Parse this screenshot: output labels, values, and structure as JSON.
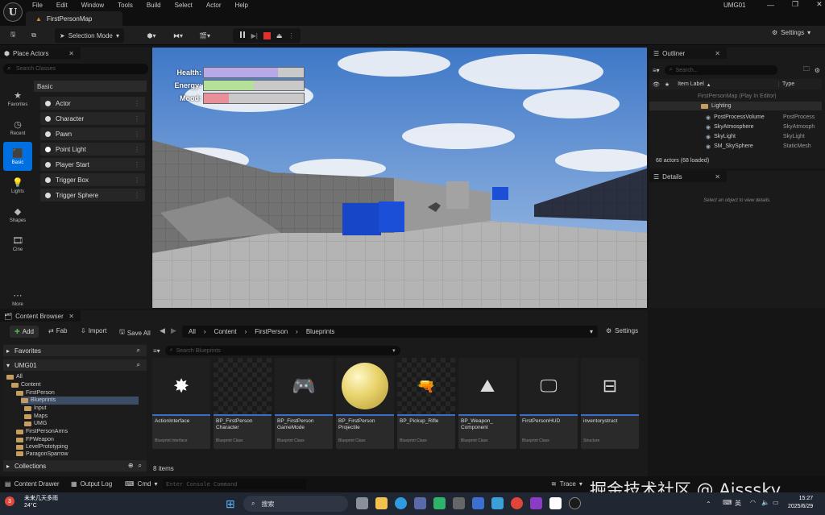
{
  "window": {
    "project_name": "UMG01",
    "map_tab": "FirstPersonMap",
    "menu": [
      "File",
      "Edit",
      "Window",
      "Tools",
      "Build",
      "Select",
      "Actor",
      "Help"
    ],
    "logo_letter": "U"
  },
  "toolbar": {
    "selection_mode": "Selection Mode",
    "settings": "Settings"
  },
  "place_actors": {
    "tab_title": "Place Actors",
    "search_placeholder": "Search Classes",
    "section": "Basic",
    "categories": [
      {
        "label": "Favorites",
        "icon": "star-icon"
      },
      {
        "label": "Recent",
        "icon": "clock-icon"
      },
      {
        "label": "Basic",
        "icon": "cube-icon"
      },
      {
        "label": "Lights",
        "icon": "bulb-icon"
      },
      {
        "label": "Shapes",
        "icon": "shapes-icon"
      },
      {
        "label": "Cine",
        "icon": "film-icon"
      },
      {
        "label": "More",
        "icon": "more-icon"
      }
    ],
    "actors": [
      "Actor",
      "Character",
      "Pawn",
      "Point Light",
      "Player Start",
      "Trigger Box",
      "Trigger Sphere"
    ]
  },
  "hud": {
    "bars": [
      {
        "label": "Health:",
        "value": 0.74,
        "color": "#b7a9e8"
      },
      {
        "label": "Energy:",
        "value": 0.5,
        "color": "#b5e09a"
      },
      {
        "label": "Mood:",
        "value": 0.25,
        "color": "#e88f9a"
      }
    ]
  },
  "outliner": {
    "tab_title": "Outliner",
    "search_placeholder": "Search...",
    "col_label": "Item Label",
    "col_type": "Type",
    "rows": [
      {
        "label": "FirstPersonMap (Play In Editor)",
        "type": ""
      },
      {
        "label": "Lighting",
        "type": ""
      },
      {
        "label": "PostProcessVolume",
        "type": "PostProcess"
      },
      {
        "label": "SkyAtmosphere",
        "type": "SkyAtmosph"
      },
      {
        "label": "SkyLight",
        "type": "SkyLight"
      },
      {
        "label": "SM_SkySphere",
        "type": "StaticMesh"
      }
    ],
    "count": "68 actors (68 loaded)"
  },
  "details": {
    "tab_title": "Details",
    "empty": "Select an object to view details."
  },
  "content_browser": {
    "tab_title": "Content Browser",
    "add": "Add",
    "fab": "Fab",
    "import": "Import",
    "save_all": "Save All",
    "path": [
      "All",
      "Content",
      "FirstPerson",
      "Blueprints"
    ],
    "settings": "Settings",
    "favorites": "Favorites",
    "project": "UMG01",
    "collections": "Collections",
    "search_placeholder": "Search Blueprints",
    "tree": [
      "All",
      "Content",
      "FirstPerson",
      "Blueprints",
      "Input",
      "Maps",
      "UMG",
      "FirstPersonArms",
      "FPWeapon",
      "LevelPrototyping",
      "ParagonSparrow"
    ],
    "assets": [
      {
        "name": "ActionInterface",
        "type": "Blueprint Interface"
      },
      {
        "name": "BP_FirstPerson Character",
        "type": "Blueprint Class"
      },
      {
        "name": "BP_FirstPerson GameMode",
        "type": "Blueprint Class"
      },
      {
        "name": "BP_FirstPerson Projectile",
        "type": "Blueprint Class"
      },
      {
        "name": "BP_Pickup_Rifle",
        "type": "Blueprint Class"
      },
      {
        "name": "BP_Weapon_ Component",
        "type": "Blueprint Class"
      },
      {
        "name": "FirstPersonHUD",
        "type": "Blueprint Class"
      },
      {
        "name": "inventorystruct",
        "type": "Structure"
      }
    ],
    "item_count": "8 items"
  },
  "statusbar": {
    "content_drawer": "Content Drawer",
    "output_log": "Output Log",
    "cmd": "Cmd",
    "console_placeholder": "Enter Console Command",
    "trace": "Trace"
  },
  "taskbar": {
    "weather": "未来几天多雨",
    "temp": "24°C",
    "search": "搜索",
    "ime": "英",
    "time": "15:27",
    "date": "2025/6/29",
    "badge": "3"
  },
  "watermark": "掘金技术社区 @ Aisssky"
}
